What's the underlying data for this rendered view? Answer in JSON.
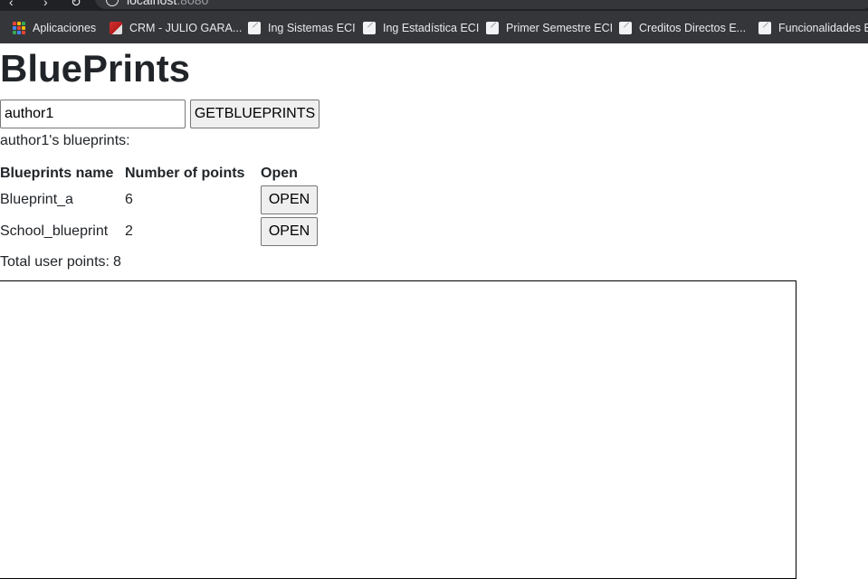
{
  "browser": {
    "url_host": "localhost",
    "url_port": ":8080",
    "bookmarks": [
      {
        "label": "Aplicaciones",
        "icon": "apps-grid-icon"
      },
      {
        "label": "CRM - JULIO GARA...",
        "icon": "crm-icon"
      },
      {
        "label": "Ing Sistemas ECI",
        "icon": "page-icon"
      },
      {
        "label": "Ing Estadística ECI",
        "icon": "page-icon"
      },
      {
        "label": "Primer Semestre ECI",
        "icon": "page-icon"
      },
      {
        "label": "Creditos Directos E...",
        "icon": "page-icon"
      },
      {
        "label": "Funcionalidades En",
        "icon": "page-icon"
      }
    ]
  },
  "page": {
    "title": "BluePrints",
    "author_input_value": "author1",
    "get_button_label": "GETBLUEPRINTS",
    "author_heading": "author1's blueprints:",
    "table": {
      "headers": [
        "Blueprints name",
        "Number of points",
        "Open"
      ],
      "rows": [
        {
          "name": "Blueprint_a",
          "points": "6",
          "open_label": "OPEN"
        },
        {
          "name": "School_blueprint",
          "points": "2",
          "open_label": "OPEN"
        }
      ]
    },
    "total_label": "Total user points:",
    "total_value": "8"
  }
}
